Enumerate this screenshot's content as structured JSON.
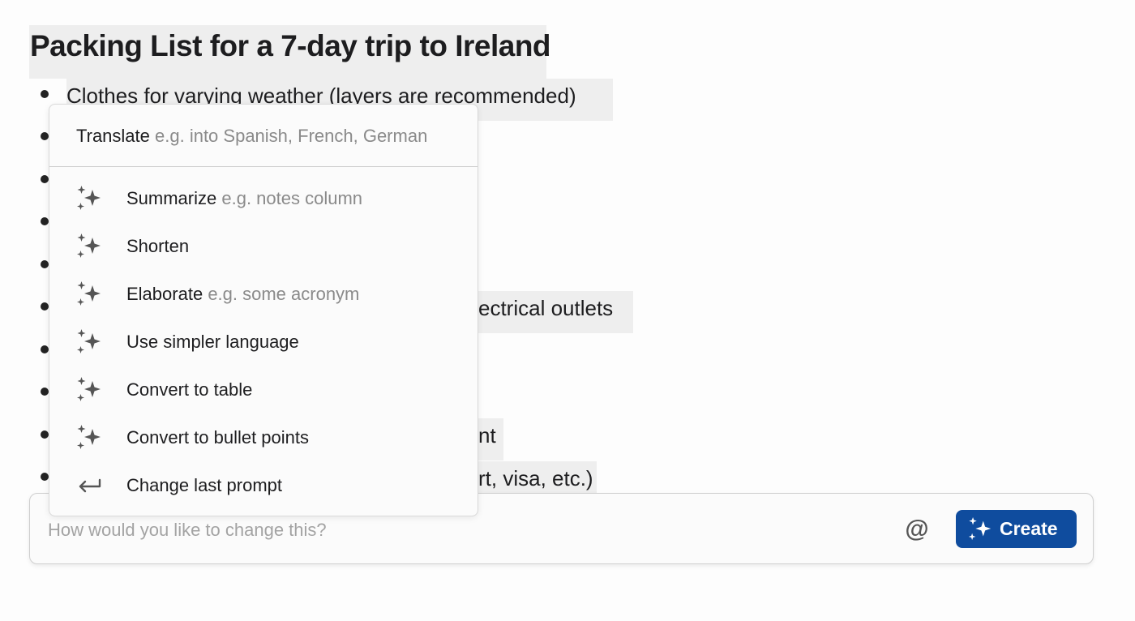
{
  "document": {
    "title": "Packing List for a 7-day trip to Ireland",
    "bullets": [
      {
        "visible_text": "Clothes for varying weather (layers are recommended)"
      },
      {
        "visible_text": ""
      },
      {
        "visible_text": ""
      },
      {
        "visible_text": ""
      },
      {
        "visible_text": ""
      },
      {
        "visible_text": "ectrical outlets"
      },
      {
        "visible_text": ""
      },
      {
        "visible_text": ""
      },
      {
        "visible_text": "nt"
      },
      {
        "visible_text": "rt, visa, etc.)"
      }
    ]
  },
  "menu": {
    "translate": {
      "label": "Translate",
      "hint": "e.g. into Spanish, French, German"
    },
    "items": [
      {
        "label": "Summarize",
        "hint": "e.g. notes column",
        "icon": "sparkle-icon"
      },
      {
        "label": "Shorten",
        "hint": "",
        "icon": "sparkle-icon"
      },
      {
        "label": "Elaborate",
        "hint": "e.g. some acronym",
        "icon": "sparkle-icon"
      },
      {
        "label": "Use simpler language",
        "hint": "",
        "icon": "sparkle-icon"
      },
      {
        "label": "Convert to table",
        "hint": "",
        "icon": "sparkle-icon"
      },
      {
        "label": "Convert to bullet points",
        "hint": "",
        "icon": "sparkle-icon"
      },
      {
        "label": "Change last prompt",
        "hint": "",
        "icon": "return-arrow-icon"
      }
    ]
  },
  "prompt": {
    "placeholder": "How would you like to change this?",
    "value": "",
    "mention_symbol": "@",
    "create_label": "Create"
  },
  "colors": {
    "accent": "#0f4c9e",
    "highlight": "#eeeeee"
  }
}
